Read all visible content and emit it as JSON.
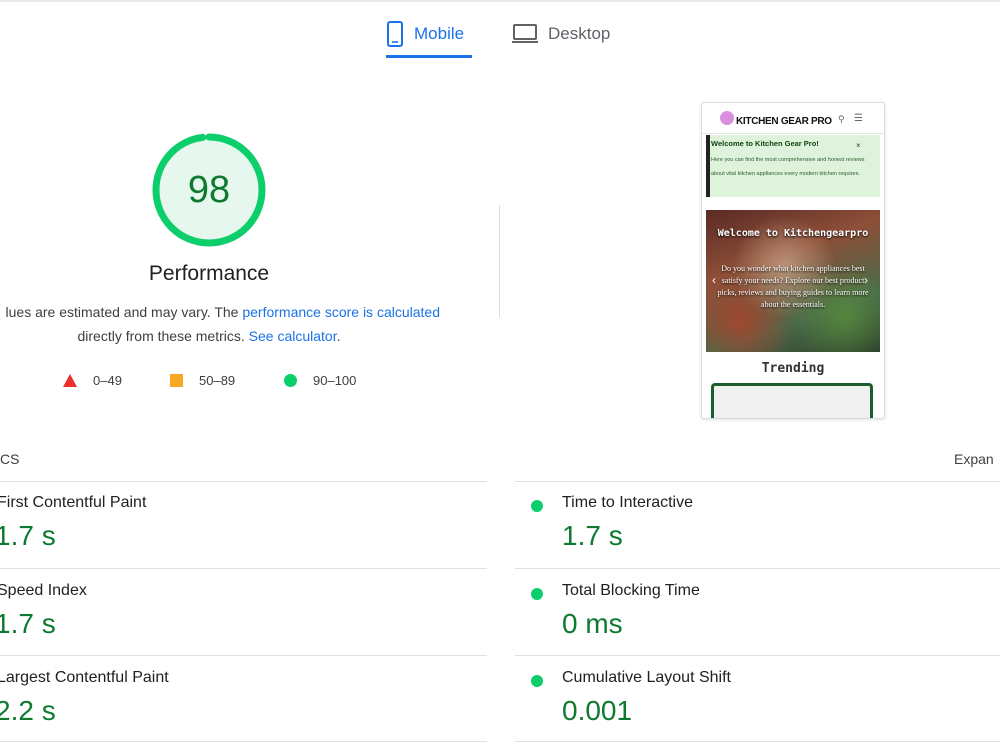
{
  "tabs": [
    {
      "label": "Mobile",
      "active": true
    },
    {
      "label": "Desktop",
      "active": false
    }
  ],
  "score": {
    "value": "98",
    "fraction": 0.98,
    "label": "Performance",
    "color": "#0cce6b"
  },
  "description": {
    "line1_text": "lues are estimated and may vary. The ",
    "line1_link": "performance score is calculated",
    "line2_text": "directly from these metrics. ",
    "line2_link": "See calculator",
    "line2_end": "."
  },
  "legend": [
    {
      "icon": "triangle-icon",
      "range": "0–49",
      "color": "#e8312a"
    },
    {
      "icon": "square-icon",
      "range": "50–89",
      "color": "#f9a825"
    },
    {
      "icon": "circle-icon",
      "range": "90–100",
      "color": "#0cce6b"
    }
  ],
  "thumbnail": {
    "brand": "KITCHEN GEAR PRO",
    "banner_title": "Welcome to Kitchen Gear Pro!",
    "banner_close": "×",
    "banner_text": "Here you can find the most comprehensive and honest reviews about vital kitchen appliances every modern kitchen requires.",
    "hero_title": "Welcome to Kitchengearpro",
    "hero_text": "Do you wonder what kitchen appliances best satisfy your needs? Explore our best product picks, reviews and buying guides to learn more about the essentials.",
    "section_title": "Trending"
  },
  "metrics_header": {
    "left": "CS",
    "right": "Expan"
  },
  "metrics": {
    "fcp": {
      "label": "First Contentful Paint",
      "value": "1.7 s"
    },
    "si": {
      "label": "Speed Index",
      "value": "1.7 s"
    },
    "lcp": {
      "label": "Largest Contentful Paint",
      "value": "2.2 s"
    },
    "tti": {
      "label": "Time to Interactive",
      "value": "1.7 s"
    },
    "tbt": {
      "label": "Total Blocking Time",
      "value": "0 ms"
    },
    "cls": {
      "label": "Cumulative Layout Shift",
      "value": "0.001"
    }
  }
}
